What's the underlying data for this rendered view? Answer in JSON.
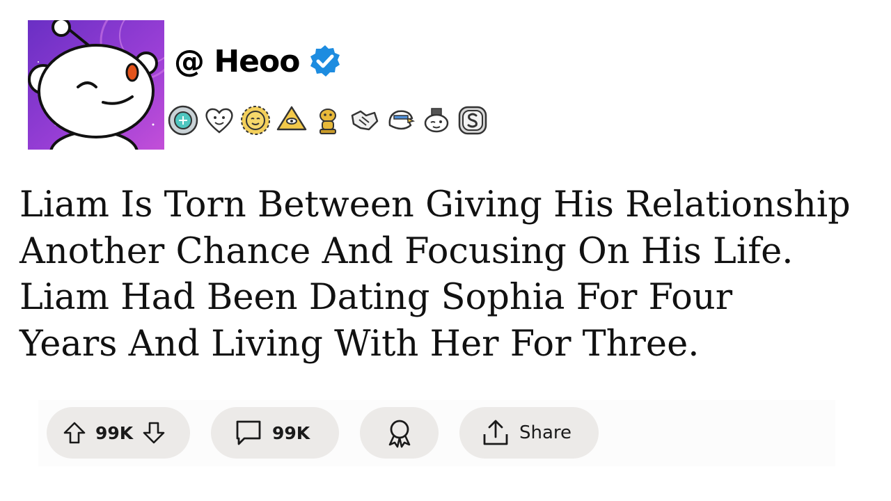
{
  "post": {
    "handle": "@ Heoo",
    "title": "Liam Is Torn Between Giving His Relationship\nAnother Chance And Focusing On His Life.\nLiam Had Been Dating Sophia For Four\nYears And Living With Her For Three."
  },
  "awards": [
    "silver-gem-award-icon",
    "heart-face-award-icon",
    "sun-face-award-icon",
    "gold-pyramid-award-icon",
    "gold-snoo-trophy-award-icon",
    "handshake-award-icon",
    "eagle-award-icon",
    "wink-snoo-award-icon",
    "silver-coin-award-icon"
  ],
  "actions": {
    "upvote_count": "99K",
    "comment_count": "99K",
    "share_label": "Share"
  },
  "colors": {
    "verified": "#1d8ce0",
    "avatar_bg": "#8a3fd1",
    "pill_bg": "#eceae8",
    "snoo_eye": "#e2531b"
  }
}
